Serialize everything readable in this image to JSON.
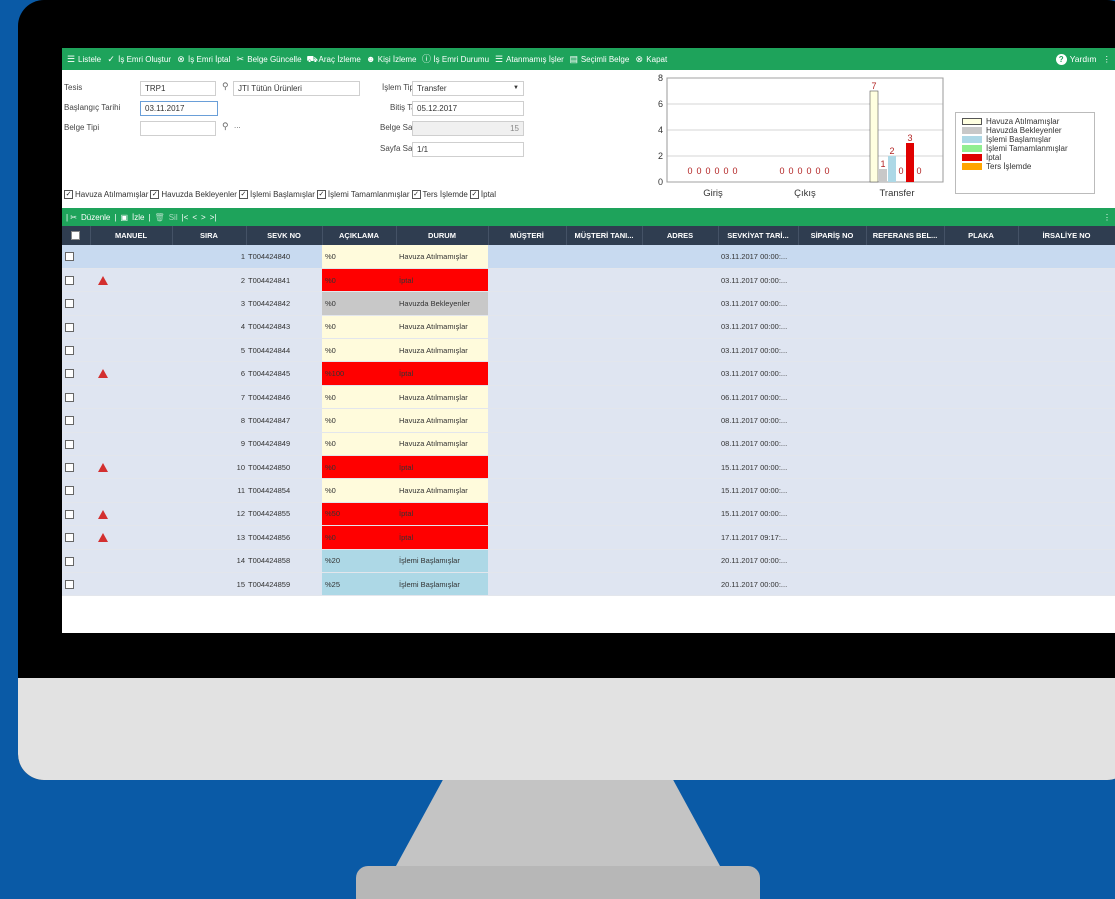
{
  "toolbar": {
    "items": [
      {
        "label": "Listele",
        "icon": "list-icon",
        "glyph": "☰"
      },
      {
        "label": "İş Emri Oluştur",
        "icon": "check-icon",
        "glyph": "✓"
      },
      {
        "label": "İş Emri İptal",
        "icon": "cancel-circle-icon",
        "glyph": "⊗"
      },
      {
        "label": "Belge Güncelle",
        "icon": "scissors-icon",
        "glyph": "✂"
      },
      {
        "label": "Araç İzleme",
        "icon": "truck-icon",
        "glyph": "⛟"
      },
      {
        "label": "Kişi İzleme",
        "icon": "person-icon",
        "glyph": "☻"
      },
      {
        "label": "İş Emri Durumu",
        "icon": "info-shield-icon",
        "glyph": "ⓘ"
      },
      {
        "label": "Atanmamış İşler",
        "icon": "list-icon",
        "glyph": "☰"
      },
      {
        "label": "Seçimli Belge",
        "icon": "document-icon",
        "glyph": "▤"
      },
      {
        "label": "Kapat",
        "icon": "close-circle-icon",
        "glyph": "⊗"
      }
    ],
    "help": "Yardım"
  },
  "filters": {
    "tesis_label": "Tesis",
    "tesis_value": "TRP1",
    "tesis_name": "JTI Tütün Ürünleri",
    "baslangic_label": "Başlangıç Tarihi",
    "baslangic_value": "03.11.2017",
    "belge_tipi_label": "Belge Tipi",
    "belge_tipi_value": "",
    "dots": "...",
    "islem_tipi_label": "İşlem Tipi",
    "islem_tipi_value": "Transfer",
    "bitis_label": "Bitiş Tarihi",
    "bitis_value": "05.12.2017",
    "belge_sayisi_label": "Belge Sayısı",
    "belge_sayisi_value": "15",
    "sayfa_sayisi_label": "Sayfa Sayısı",
    "sayfa_sayisi_value": "1/1",
    "checkboxes": [
      {
        "label": "Havuza Atılmamışlar",
        "checked": true
      },
      {
        "label": "Havuzda Bekleyenler",
        "checked": true
      },
      {
        "label": "İşlemi Başlamışlar",
        "checked": true
      },
      {
        "label": "İşlemi Tamamlanmışlar",
        "checked": true
      },
      {
        "label": "Ters İşlemde",
        "checked": true
      },
      {
        "label": "İptal",
        "checked": true
      }
    ]
  },
  "chart_data": {
    "type": "bar",
    "categories": [
      "Giriş",
      "Çıkış",
      "Transfer"
    ],
    "ylim": [
      0,
      8
    ],
    "yticks": [
      0,
      2,
      4,
      6,
      8
    ],
    "series": [
      {
        "name": "Havuza Atılmamışlar",
        "color": "#ffffe0",
        "values": [
          0,
          0,
          7
        ]
      },
      {
        "name": "Havuzda Bekleyenler",
        "color": "#c8c8c8",
        "values": [
          0,
          0,
          1
        ]
      },
      {
        "name": "İşlemi Başlamışlar",
        "color": "#add8e6",
        "values": [
          0,
          0,
          2
        ]
      },
      {
        "name": "İşlemi Tamamlanmışlar",
        "color": "#90ee90",
        "values": [
          0,
          0,
          0
        ]
      },
      {
        "name": "İptal",
        "color": "#e00000",
        "values": [
          0,
          0,
          3
        ]
      },
      {
        "name": "Ters İşlemde",
        "color": "#ffa500",
        "values": [
          0,
          0,
          0
        ]
      }
    ],
    "grid": true,
    "legend": "right"
  },
  "gridbar": {
    "edit": "Düzenle",
    "watch": "İzle",
    "delete": "Sil",
    "nav": [
      "|<",
      "<",
      ">",
      ">|"
    ]
  },
  "table": {
    "columns": [
      "MANUEL",
      "SIRA",
      "SEVK NO",
      "AÇIKLAMA",
      "DURUM",
      "MÜŞTERİ",
      "MÜŞTERİ TANI...",
      "ADRES",
      "SEVKİYAT TARİ...",
      "SİPARİŞ NO",
      "REFERANS BEL...",
      "PLAKA",
      "İRSALİYE NO"
    ],
    "rows": [
      {
        "warn": false,
        "sira": "1",
        "sevk": "T004424840",
        "aciklama": "%0",
        "durum": "Havuza Atılmamışlar",
        "color": "#fffbdc",
        "tarih": "03.11.2017 00:00:..."
      },
      {
        "warn": true,
        "sira": "2",
        "sevk": "T004424841",
        "aciklama": "%0",
        "durum": "İptal",
        "color": "#ff0000",
        "tarih": "03.11.2017 00:00:..."
      },
      {
        "warn": false,
        "sira": "3",
        "sevk": "T004424842",
        "aciklama": "%0",
        "durum": "Havuzda Bekleyenler",
        "color": "#c8c8c8",
        "tarih": "03.11.2017 00:00:..."
      },
      {
        "warn": false,
        "sira": "4",
        "sevk": "T004424843",
        "aciklama": "%0",
        "durum": "Havuza Atılmamışlar",
        "color": "#fffbdc",
        "tarih": "03.11.2017 00:00:..."
      },
      {
        "warn": false,
        "sira": "5",
        "sevk": "T004424844",
        "aciklama": "%0",
        "durum": "Havuza Atılmamışlar",
        "color": "#fffbdc",
        "tarih": "03.11.2017 00:00:..."
      },
      {
        "warn": true,
        "sira": "6",
        "sevk": "T004424845",
        "aciklama": "%100",
        "durum": "İptal",
        "color": "#ff0000",
        "tarih": "03.11.2017 00:00:..."
      },
      {
        "warn": false,
        "sira": "7",
        "sevk": "T004424846",
        "aciklama": "%0",
        "durum": "Havuza Atılmamışlar",
        "color": "#fffbdc",
        "tarih": "06.11.2017 00:00:..."
      },
      {
        "warn": false,
        "sira": "8",
        "sevk": "T004424847",
        "aciklama": "%0",
        "durum": "Havuza Atılmamışlar",
        "color": "#fffbdc",
        "tarih": "08.11.2017 00:00:..."
      },
      {
        "warn": false,
        "sira": "9",
        "sevk": "T004424849",
        "aciklama": "%0",
        "durum": "Havuza Atılmamışlar",
        "color": "#fffbdc",
        "tarih": "08.11.2017 00:00:..."
      },
      {
        "warn": true,
        "sira": "10",
        "sevk": "T004424850",
        "aciklama": "%0",
        "durum": "İptal",
        "color": "#ff0000",
        "tarih": "15.11.2017 00:00:..."
      },
      {
        "warn": false,
        "sira": "11",
        "sevk": "T004424854",
        "aciklama": "%0",
        "durum": "Havuza Atılmamışlar",
        "color": "#fffbdc",
        "tarih": "15.11.2017 00:00:..."
      },
      {
        "warn": true,
        "sira": "12",
        "sevk": "T004424855",
        "aciklama": "%50",
        "durum": "İptal",
        "color": "#ff0000",
        "tarih": "15.11.2017 00:00:..."
      },
      {
        "warn": true,
        "sira": "13",
        "sevk": "T004424856",
        "aciklama": "%0",
        "durum": "İptal",
        "color": "#ff0000",
        "tarih": "17.11.2017 09:17:..."
      },
      {
        "warn": false,
        "sira": "14",
        "sevk": "T004424858",
        "aciklama": "%20",
        "durum": "İşlemi Başlamışlar",
        "color": "#add8e6",
        "tarih": "20.11.2017 00:00:..."
      },
      {
        "warn": false,
        "sira": "15",
        "sevk": "T004424859",
        "aciklama": "%25",
        "durum": "İşlemi Başlamışlar",
        "color": "#add8e6",
        "tarih": "20.11.2017 00:00:..."
      }
    ]
  }
}
